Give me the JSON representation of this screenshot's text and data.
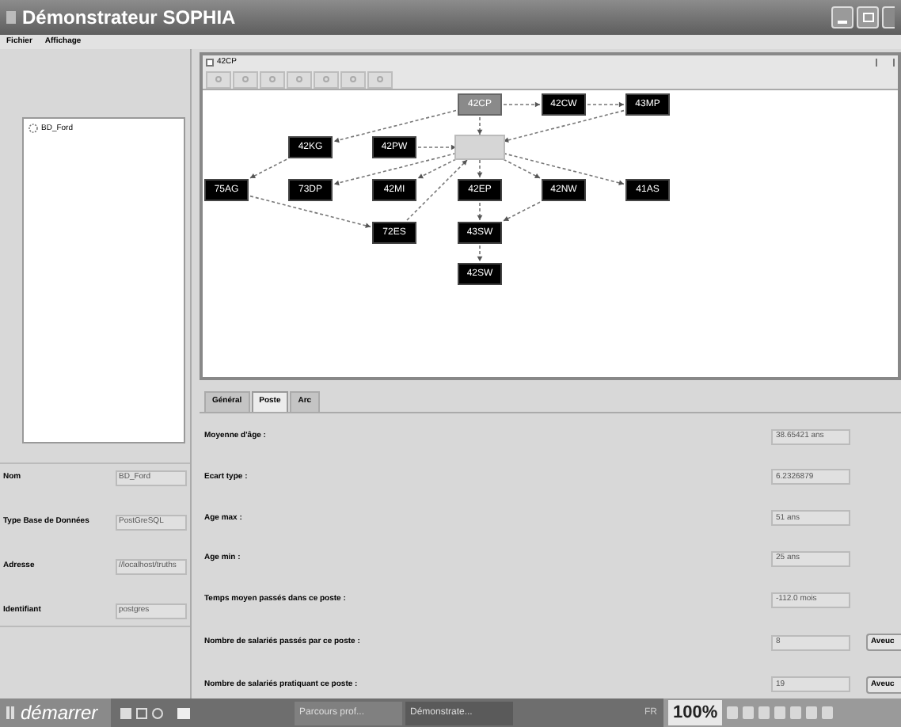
{
  "window": {
    "title": "Démonstrateur SOPHIA"
  },
  "menu": [
    "Fichier",
    "Affichage"
  ],
  "tree": {
    "items": [
      {
        "label": "BD_Ford"
      }
    ]
  },
  "database_fields": [
    {
      "label": "Nom",
      "value": "BD_Ford"
    },
    {
      "label": "Type Base de Données",
      "value": "PostGreSQL"
    },
    {
      "label": "Adresse",
      "value": "//localhost/truths"
    },
    {
      "label": "Identifiant",
      "value": "postgres"
    }
  ],
  "graph_window": {
    "title": "42CP"
  },
  "nodes": [
    {
      "label": "42CP",
      "kind": "selected"
    },
    {
      "kind": "ghost"
    },
    {
      "label": "42CW",
      "kind": "normal"
    },
    {
      "label": "43MP",
      "kind": "normal"
    },
    {
      "label": "42KG",
      "kind": "normal"
    },
    {
      "label": "42PW",
      "kind": "normal"
    },
    {
      "label": "75AG",
      "kind": "normal"
    },
    {
      "label": "73DP",
      "kind": "normal"
    },
    {
      "label": "42MI",
      "kind": "normal"
    },
    {
      "label": "42EP",
      "kind": "normal"
    },
    {
      "label": "42NW",
      "kind": "normal"
    },
    {
      "label": "41AS",
      "kind": "normal"
    },
    {
      "label": "72ES",
      "kind": "normal"
    },
    {
      "label": "43SW",
      "kind": "normal"
    },
    {
      "label": "42SW",
      "kind": "normal"
    }
  ],
  "tabs": [
    {
      "label": "Général",
      "selected": false
    },
    {
      "label": "Poste",
      "selected": true
    },
    {
      "label": "Arc",
      "selected": false
    }
  ],
  "statistics": [
    {
      "label": "Moyenne d'âge :",
      "value": "38.65421 ans"
    },
    {
      "label": "Ecart type :",
      "value": "6.2326879"
    },
    {
      "label": "Age max :",
      "value": "51 ans"
    },
    {
      "label": "Age min :",
      "value": "25 ans"
    },
    {
      "label": "Temps moyen passés dans ce poste :",
      "value": "-112.0 mois"
    },
    {
      "label": "Nombre de salariés passés par ce poste :",
      "value": "8",
      "button": "Aveuc"
    },
    {
      "label": "Nombre de salariés pratiquant ce poste :",
      "value": "19",
      "button": "Aveuc"
    }
  ],
  "taskbar": {
    "start": "démarrer",
    "tasks": [
      {
        "label": "Parcours prof...",
        "selected": false
      },
      {
        "label": "Démonstrate...",
        "selected": true
      }
    ],
    "language": "FR",
    "zoom": "100%"
  }
}
